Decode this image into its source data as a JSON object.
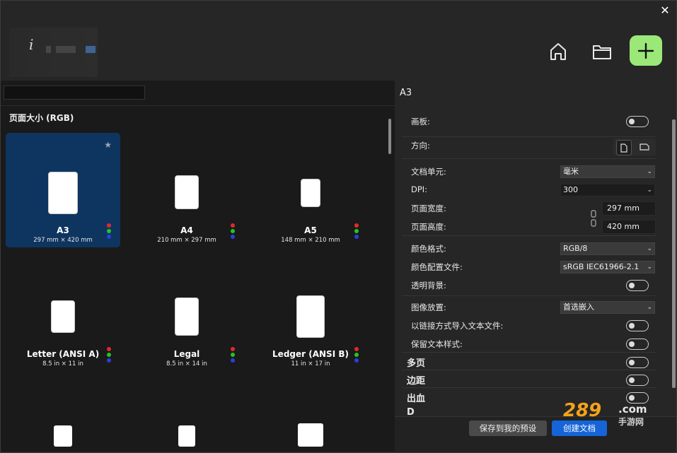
{
  "window": {
    "close_glyph": "✕"
  },
  "header": {
    "icons": [
      "home-icon",
      "folder-icon",
      "plus-icon"
    ],
    "accent": "#9be879"
  },
  "left": {
    "search_value": "",
    "section_title": "页面大小 (RGB)",
    "cards": [
      {
        "name": "A3",
        "dims": "297 mm × 420 mm",
        "selected": true
      },
      {
        "name": "A4",
        "dims": "210 mm × 297 mm"
      },
      {
        "name": "A5",
        "dims": "148 mm × 210 mm"
      },
      {
        "name": "Letter (ANSI A)",
        "dims": "8.5 in × 11 in"
      },
      {
        "name": "Legal",
        "dims": "8.5 in × 14 in"
      },
      {
        "name": "Ledger (ANSI B)",
        "dims": "11 in × 17 in"
      }
    ],
    "selected_color": "#0e3560"
  },
  "right": {
    "title": "A3",
    "artboard_label": "画板:",
    "orientation_label": "方向:",
    "doc_units_label": "文档单元:",
    "doc_units_value": "毫米",
    "dpi_label": "DPI:",
    "dpi_value": "300",
    "page_width_label": "页面宽度:",
    "page_width_value": "297 mm",
    "page_height_label": "页面高度:",
    "page_height_value": "420 mm",
    "color_format_label": "颜色格式:",
    "color_format_value": "RGB/8",
    "color_profile_label": "颜色配置文件:",
    "color_profile_value": "sRGB IEC61966-2.1",
    "transparent_bg_label": "透明背景:",
    "image_placement_label": "图像放置:",
    "image_placement_value": "首选嵌入",
    "import_linked_label": "以链接方式导入文本文件:",
    "keep_text_style_label": "保留文本样式:",
    "multipage_label": "多页",
    "margins_label": "边距",
    "bleed_label": "出血",
    "partial_label": "D"
  },
  "footer": {
    "save_preset_label": "保存到我的预设",
    "create_label": "创建文档",
    "create_color": "#1565d8"
  },
  "watermark": {
    "text": "289",
    "subtext": "手游网",
    "suffix": ".com"
  }
}
